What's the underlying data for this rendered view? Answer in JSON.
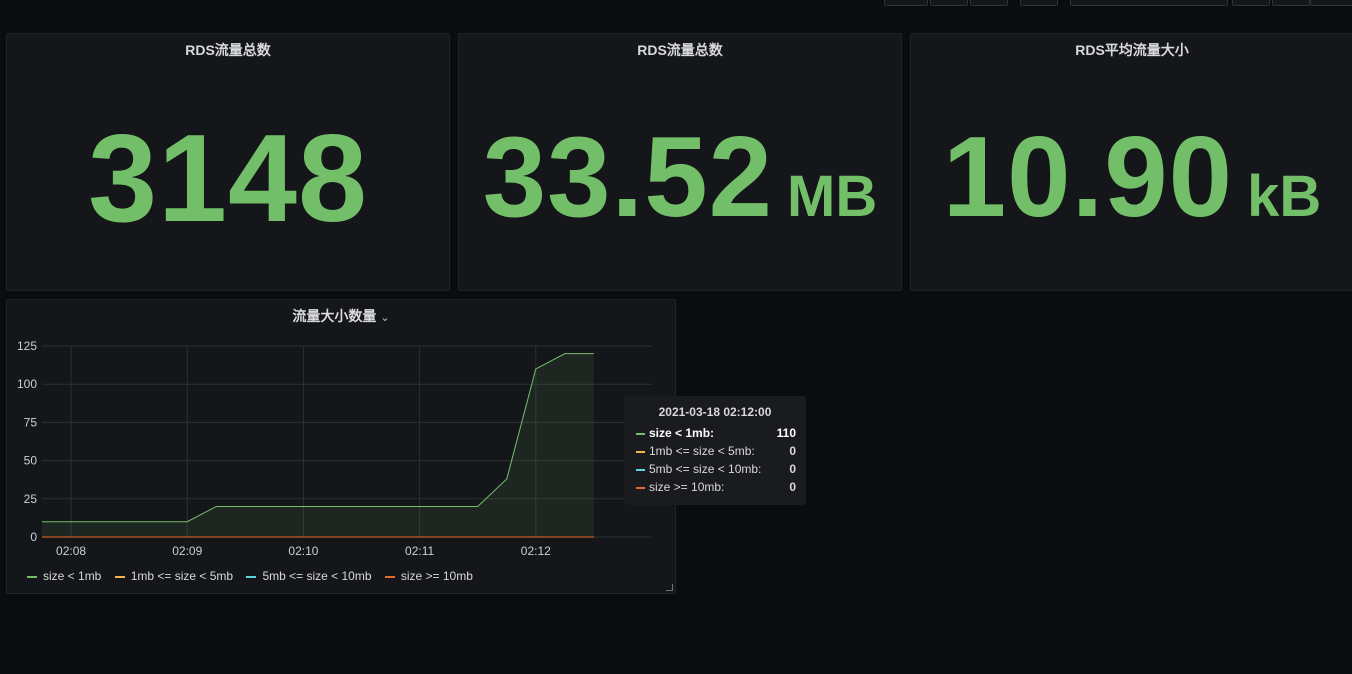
{
  "stats": [
    {
      "title": "RDS流量总数",
      "value": "3148",
      "unit": ""
    },
    {
      "title": "RDS流量总数",
      "value": "33.52",
      "unit": "MB"
    },
    {
      "title": "RDS平均流量大小",
      "value": "10.90",
      "unit": "kB"
    }
  ],
  "graph": {
    "title": "流量大小数量",
    "chevron": "⌄"
  },
  "tooltip": {
    "time": "2021-03-18 02:12:00",
    "rows": [
      {
        "label": "size < 1mb:",
        "value": "110",
        "color": "#73bf69"
      },
      {
        "label": "1mb <= size < 5mb:",
        "value": "0",
        "color": "#f2b84b"
      },
      {
        "label": "5mb <= size < 10mb:",
        "value": "0",
        "color": "#5ad6e3"
      },
      {
        "label": "size >= 10mb:",
        "value": "0",
        "color": "#e66b2a"
      }
    ]
  },
  "chart_data": {
    "type": "line",
    "x": [
      "02:07:45",
      "02:08",
      "02:08:15",
      "02:08:30",
      "02:08:45",
      "02:09",
      "02:09:15",
      "02:09:30",
      "02:09:45",
      "02:10",
      "02:10:15",
      "02:10:30",
      "02:10:45",
      "02:11",
      "02:11:15",
      "02:11:30",
      "02:11:45",
      "02:12",
      "02:12:15",
      "02:12:30"
    ],
    "xticks": [
      "02:08",
      "02:09",
      "02:10",
      "02:11",
      "02:12"
    ],
    "yticks": [
      "0",
      "25",
      "50",
      "75",
      "100",
      "125"
    ],
    "ylim": [
      0,
      125
    ],
    "series": [
      {
        "name": "size < 1mb",
        "color": "#73bf69",
        "values": [
          10,
          10,
          10,
          10,
          10,
          10,
          20,
          20,
          20,
          20,
          20,
          20,
          20,
          20,
          20,
          20,
          38,
          110,
          120,
          120
        ]
      },
      {
        "name": "1mb <= size < 5mb",
        "color": "#f2b84b",
        "values": [
          0,
          0,
          0,
          0,
          0,
          0,
          0,
          0,
          0,
          0,
          0,
          0,
          0,
          0,
          0,
          0,
          0,
          0,
          0,
          0
        ]
      },
      {
        "name": "5mb <= size < 10mb",
        "color": "#5ad6e3",
        "values": [
          0,
          0,
          0,
          0,
          0,
          0,
          0,
          0,
          0,
          0,
          0,
          0,
          0,
          0,
          0,
          0,
          0,
          0,
          0,
          0
        ]
      },
      {
        "name": "size >= 10mb",
        "color": "#e66b2a",
        "values": [
          0,
          0,
          0,
          0,
          0,
          0,
          0,
          0,
          0,
          0,
          0,
          0,
          0,
          0,
          0,
          0,
          0,
          0,
          0,
          0
        ]
      }
    ]
  }
}
